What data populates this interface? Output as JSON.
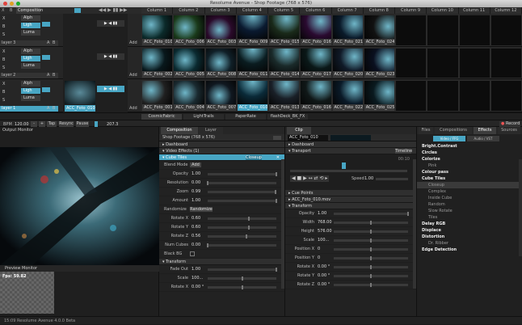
{
  "window": {
    "title": "Resolume Avenue - Shop Footage (768 x 576)"
  },
  "composition": {
    "label": "Composition"
  },
  "columns": [
    "Column 1",
    "Column 2",
    "Column 3",
    "Column 4",
    "Column 5",
    "Column 6",
    "Column 7",
    "Column 8",
    "Column 9",
    "Column 10",
    "Column 11",
    "Column 12"
  ],
  "blend_modes": [
    "Alph",
    "Ligh",
    "Luma"
  ],
  "small_labels": {
    "x": "X",
    "b": "B",
    "s": "S",
    "a": "A",
    "add": "Add"
  },
  "layers": [
    {
      "name": "layer 3",
      "clips": [
        "ACC_Foto_010",
        "ACC_Foto_006",
        "ACC_Foto_003",
        "ACC_Foto_009",
        "ACC_Foto_015",
        "ACC_Foto_016",
        "ACC_Foto_021",
        "ACC_Foto_024",
        "",
        "",
        "",
        ""
      ]
    },
    {
      "name": "layer 2",
      "clips": [
        "ACC_Foto_002",
        "ACC_Foto_005",
        "ACC_Foto_008",
        "ACC_Foto_011",
        "ACC_Foto_014",
        "ACC_Foto_017",
        "ACC_Foto_020",
        "ACC_Foto_023",
        "",
        "",
        "",
        ""
      ]
    },
    {
      "name": "layer 1",
      "clips": [
        "ACC_Foto_001",
        "ACC_Foto_004",
        "ACC_Foto_007",
        "ACC_Foto_010",
        "ACC_Foto_013",
        "ACC_Foto_016",
        "ACC_Foto_022",
        "ACC_Foto_025",
        "",
        "",
        "",
        ""
      ]
    }
  ],
  "layer1_preview_clip": "ACC_Foto_010",
  "decks": [
    "CosmicFabric",
    "LightTrails",
    "PaperRate",
    "flashDeck_BK_FX"
  ],
  "bpm": {
    "label": "BPM",
    "value": "120.00",
    "minus": "-",
    "plus": "+",
    "tap": "Tap",
    "resync": "Resync",
    "pause": "Pause",
    "beat_value": "207.3",
    "record": "Record"
  },
  "output_monitor": {
    "title": "Output Monitor"
  },
  "preview_monitor": {
    "title": "Preview Monitor",
    "fps": "Fps: 59.82"
  },
  "status_bar": {
    "text": "15:09   Resolume Avenue 4.0.0 Beta"
  },
  "comp_panel": {
    "tabs": [
      "Composition",
      "Layer"
    ],
    "title": "Shop Footage (768 x 576)",
    "sections": {
      "dashboard": "Dashboard",
      "video_effects": "Video Effects (1)",
      "cube_tiles": "Cube Tiles",
      "transform": "Transform"
    },
    "cube_tiles_mode": "Closeup",
    "blend_mode": {
      "label": "Blend Mode",
      "value": "Add"
    },
    "params": [
      {
        "label": "Opacity",
        "value": "1.00",
        "pos": 1.0
      },
      {
        "label": "Resolution",
        "value": "0.00",
        "pos": 0.0
      },
      {
        "label": "Zoom",
        "value": "0.99",
        "pos": 0.99
      },
      {
        "label": "Amount",
        "value": "1.00",
        "pos": 1.0
      }
    ],
    "randomize": {
      "label": "Randomize",
      "value": "Randomize"
    },
    "rotate_params": [
      {
        "label": "Rotate X",
        "value": "0.60",
        "pos": 0.6
      },
      {
        "label": "Rotate Y",
        "value": "0.60",
        "pos": 0.6
      },
      {
        "label": "Rotate Z",
        "value": "0.56",
        "pos": 0.56
      },
      {
        "label": "Num Cubes",
        "value": "0.00",
        "pos": 0.0
      }
    ],
    "black_bg": {
      "label": "Black BG"
    },
    "transform_params": [
      {
        "label": "Fade Out",
        "value": "1.00",
        "pos": 1.0
      },
      {
        "label": "Scale",
        "value": "100...",
        "pos": 0.5
      },
      {
        "label": "Rotate X",
        "value": "0.00 °",
        "pos": 0.5
      }
    ]
  },
  "clip_panel": {
    "tab": "Clip",
    "clip_name": "ACC_Foto_010",
    "sections": {
      "dashboard": "Dashboard",
      "transport": "Transport",
      "cue_points": "Cue Points",
      "file": "ACC_Foto_010.mov",
      "transform": "Transform"
    },
    "timeline_label": "Timeline",
    "time_start": "00:00",
    "time_end": "00:10",
    "speed": {
      "label": "Speed",
      "value": "1.00"
    },
    "params": [
      {
        "label": "Opacity",
        "value": "1.00",
        "pos": 1.0
      },
      {
        "label": "Width",
        "value": "768.00",
        "pos": 0.5
      },
      {
        "label": "Height",
        "value": "576.00",
        "pos": 0.5
      },
      {
        "label": "Scale",
        "value": "100...",
        "pos": 0.5
      },
      {
        "label": "Position X",
        "value": "0",
        "pos": 0.5
      },
      {
        "label": "Position Y",
        "value": "0",
        "pos": 0.5
      },
      {
        "label": "Rotate X",
        "value": "0.00 °",
        "pos": 0.5
      },
      {
        "label": "Rotate Y",
        "value": "0.00 °",
        "pos": 0.5
      },
      {
        "label": "Rotate Z",
        "value": "0.00 °",
        "pos": 0.5
      }
    ]
  },
  "effects_panel": {
    "tabs": [
      "Files",
      "Compositions",
      "Effects",
      "Sources"
    ],
    "subtabs": [
      "Video / FFG",
      "Audio / VST"
    ],
    "items": [
      {
        "label": "Bright.Contrast",
        "type": "bold"
      },
      {
        "label": "Circles",
        "type": "bold"
      },
      {
        "label": "Colorize",
        "type": "bold"
      },
      {
        "label": "Pink",
        "type": "child"
      },
      {
        "label": "Colour pass",
        "type": "bold"
      },
      {
        "label": "Cube Tiles",
        "type": "bold"
      },
      {
        "label": "Closeup",
        "type": "child-sel"
      },
      {
        "label": "Complex",
        "type": "child"
      },
      {
        "label": "Inside Cube",
        "type": "child"
      },
      {
        "label": "Random",
        "type": "child"
      },
      {
        "label": "Slow Rotate",
        "type": "child"
      },
      {
        "label": "Tiles",
        "type": "child"
      },
      {
        "label": "Delay RGB",
        "type": "bold"
      },
      {
        "label": "Displace",
        "type": "bold"
      },
      {
        "label": "Distortion",
        "type": "bold"
      },
      {
        "label": "Dr. Ribber",
        "type": "child"
      },
      {
        "label": "Edge Detection",
        "type": "bold"
      }
    ]
  },
  "colors": {
    "accent": "#48a6c4",
    "background": "#1b1b1b"
  }
}
